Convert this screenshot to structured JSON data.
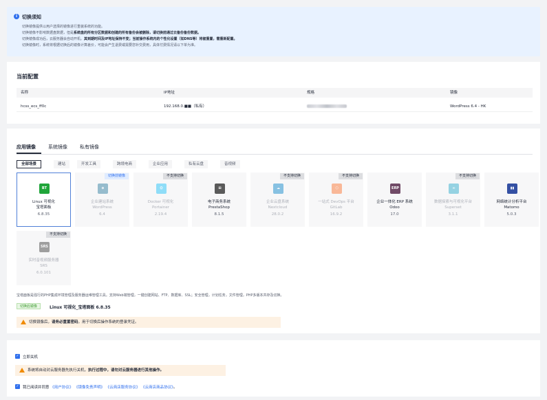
{
  "notice": {
    "title": "切换须知",
    "lines": [
      "切换镜像提供以用户选择的镜像进行重装系统的功能。",
      {
        "pre": "切换镜像不影响数据盘数据，但是",
        "bold": "系统盘的所有分区数据和创建的所有备份会被删除，请切换前通过云备份备份数据。",
        "post": ""
      },
      {
        "pre": "切换镜像成功后，云服务器会自动开机。",
        "bold": "其到期时间及IP地址保持不变；当前操作系统内的个性化设置（如DNS等）将被重置，需重新配置。",
        "post": ""
      },
      "切换镜像时，系统将根据切换后的镜像计算差价，可能会产生退费或需要您补交费用，具体付费情况请以下单为准。"
    ]
  },
  "config": {
    "title": "当前配置",
    "headers": [
      "名称",
      "IP地址",
      "规格",
      "镜像"
    ],
    "row": {
      "name": "hcss_ecs_ff0c",
      "ip": "192.168.0.■■（私有）",
      "image": "WordPress 6.4 - HK"
    }
  },
  "image_tabs": [
    "应用镜像",
    "系统镜像",
    "私有镜像"
  ],
  "filters": [
    "全部场景",
    "建站",
    "开发工具",
    "跨境电商",
    "企业应用",
    "私有云盘",
    "音视频"
  ],
  "cards": [
    {
      "name": "Linux 可视化\n宝塔面板",
      "version": "6.8.35",
      "logo": "BT",
      "color": "#20a53a",
      "badge": "",
      "selected": true,
      "disabled": false,
      "logo_icon": "bt-panel-logo"
    },
    {
      "name": "企业建站系统\nWordPress",
      "version": "6.4",
      "logo": "⊕",
      "color": "#21759b",
      "badge": "切换前镜像",
      "selected": false,
      "disabled": true,
      "logo_icon": "wordpress-logo"
    },
    {
      "name": "Docker 可视化\nPortainer",
      "version": "2.19.4",
      "logo": "⛭",
      "color": "#13bef9",
      "badge": "不支持切换",
      "selected": false,
      "disabled": true,
      "logo_icon": "portainer-logo"
    },
    {
      "name": "电子商务系统\nPrestaShop",
      "version": "8.1.5",
      "logo": "⊞",
      "color": "#5a5a5a",
      "badge": "",
      "selected": false,
      "disabled": false,
      "logo_icon": "prestashop-logo"
    },
    {
      "name": "企业云盘系统\nNextcloud",
      "version": "28.0.2",
      "logo": "☁",
      "color": "#0082c9",
      "badge": "不支持切换",
      "selected": false,
      "disabled": true,
      "logo_icon": "nextcloud-logo"
    },
    {
      "name": "一站式 DevOps 平台\nGitLab",
      "version": "16.9.2",
      "logo": "⬡",
      "color": "#fc6d26",
      "badge": "不支持切换",
      "selected": false,
      "disabled": true,
      "logo_icon": "gitlab-logo"
    },
    {
      "name": "企业一体化 ERP 系统\nOdoo",
      "version": "17.0",
      "logo": "ERP",
      "color": "#714b67",
      "badge": "",
      "selected": false,
      "disabled": false,
      "logo_icon": "odoo-logo"
    },
    {
      "name": "数据探索与可视化平台\nSuperset",
      "version": "3.1.1",
      "logo": "∞",
      "color": "#20a7c9",
      "badge": "不支持切换",
      "selected": false,
      "disabled": true,
      "logo_icon": "superset-logo"
    },
    {
      "name": "网络统计分析平台\nMatomo",
      "version": "5.0.3",
      "logo": "▮▮",
      "color": "#3450a3",
      "badge": "",
      "selected": false,
      "disabled": false,
      "logo_icon": "matomo-logo"
    },
    {
      "name": "实时音视频服务器\nSRS",
      "version": "6.0.101",
      "logo": "SRS",
      "color": "#333333",
      "badge": "不支持切换",
      "selected": false,
      "disabled": true,
      "logo_icon": "srs-logo"
    }
  ],
  "description": "宝塔面板是强行的PHP集成环境管理及服务器运维管理工具。支持Web端管理，一键创建网站、FTP、数据库、SSL；安全管理，计划任务，文件管理，PHP多版本共存及切换。",
  "after_switch": {
    "tag": "切换后镜像",
    "name": "Linux 可视化_宝塔面板 6.8.35"
  },
  "warn_password": {
    "pre": "切换镜像后，",
    "bold": "请务必重置密码",
    "post": "，用于切换后操作系统的登录凭证。"
  },
  "shutdown": {
    "label": "立即关机",
    "warn_pre": "系统将自动对云服务器先执行关机，",
    "warn_bold": "执行过程中，请勿对云服务器进行其他操作。"
  },
  "agreement": {
    "pre": "我已阅读并同意",
    "links": [
      "《用户协议》",
      "《镜像免责声明》",
      "《云商店服务协议》",
      "《云商店商品协议》"
    ],
    "post": "。"
  },
  "colors": {
    "accent": "#2f6fed",
    "warning": "#f08a00",
    "notice_bg": "#e8f2ff"
  }
}
